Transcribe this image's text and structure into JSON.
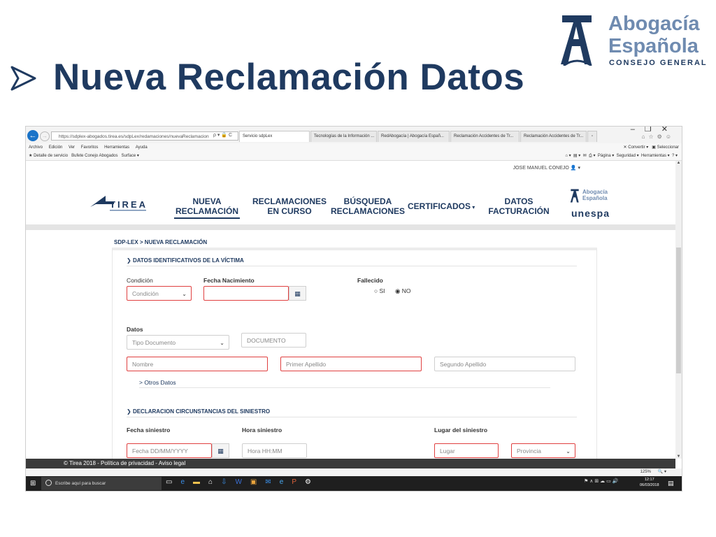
{
  "slide": {
    "bullet_icon": "arrow-bullet-icon",
    "title": "Nueva Reclamación Datos",
    "logo": {
      "line1": "Abogacía",
      "line2": "Española",
      "line3": "CONSEJO GENERAL"
    }
  },
  "browser": {
    "url": "https://sdplex-abogados.tirea.es/sdpLex/redamaciones/nuevaReclamacion",
    "addr_tools": "ρ ▾ 🔒 C",
    "tabs": [
      {
        "label": "Servicio sdpLex",
        "active": true
      },
      {
        "label": "Tecnologías de la Información ...",
        "active": false
      },
      {
        "label": "RedAbogacía | Abogacía Españ...",
        "active": false
      },
      {
        "label": "Reclamación Accidentes de Tr...",
        "active": false
      },
      {
        "label": "Reclamación Accidentes de Tr...",
        "active": false
      }
    ],
    "menu": [
      "Archivo",
      "Edición",
      "Ver",
      "Favoritos",
      "Herramientas",
      "Ayuda"
    ],
    "menu_right": [
      "Convertir",
      "Seleccionar"
    ],
    "favorites": [
      "Detalle de servicio",
      "Bufete Conejo Abogados",
      "Surface"
    ],
    "toolbar_right": [
      "Página",
      "Seguridad",
      "Herramientas"
    ],
    "zoom": "125%"
  },
  "site": {
    "user": "JOSE MANUEL CONEJO",
    "logo": "TIREA",
    "nav": [
      {
        "line1": "NUEVA",
        "line2": "RECLAMACIÓN",
        "active": true
      },
      {
        "line1": "RECLAMACIONES",
        "line2": "EN CURSO",
        "active": false
      },
      {
        "line1": "BÚSQUEDA",
        "line2": "RECLAMACIONES",
        "active": false
      },
      {
        "line1": "CERTIFICADOS",
        "line2": "",
        "active": false
      },
      {
        "line1": "DATOS",
        "line2": "FACTURACIÓN",
        "active": false
      }
    ],
    "partner_logo": {
      "line1": "Abogacía",
      "line2": "Española",
      "line3": "unespa"
    },
    "breadcrumb": "SDP-LEX > NUEVA RECLAMACIÓN"
  },
  "form": {
    "section1": "DATOS IDENTIFICATIVOS DE LA VÍCTIMA",
    "condicion_label": "Condición",
    "condicion_value": "Condición",
    "fecha_nac_label": "Fecha Nacimiento",
    "fecha_nac_value": "",
    "fallecido_label": "Fallecido",
    "opt_si": "SI",
    "opt_no": "NO",
    "fallecido_selected": "NO",
    "datos_label": "Datos",
    "tipo_doc_value": "Tipo Documento",
    "documento_placeholder": "DOCUMENTO",
    "nombre_placeholder": "Nombre",
    "apellido1_placeholder": "Primer Apellido",
    "apellido2_placeholder": "Segundo Apellido",
    "otros_datos": "> Otros Datos",
    "section2": "DECLARACION CIRCUNSTANCIAS DEL SINIESTRO",
    "fecha_sin_label": "Fecha siniestro",
    "fecha_sin_placeholder": "Fecha DD/MM/YYYY",
    "hora_sin_label": "Hora siniestro",
    "hora_sin_placeholder": "Hora HH:MM",
    "lugar_label": "Lugar del siniestro",
    "lugar_placeholder": "Lugar",
    "provincia_value": "Provincia"
  },
  "footer": {
    "text": "© Tirea 2018 - Política de privacidad - Aviso legal"
  },
  "taskbar": {
    "search": "Escribe aquí para buscar",
    "time": "12:17",
    "date": "06/03/2018"
  }
}
